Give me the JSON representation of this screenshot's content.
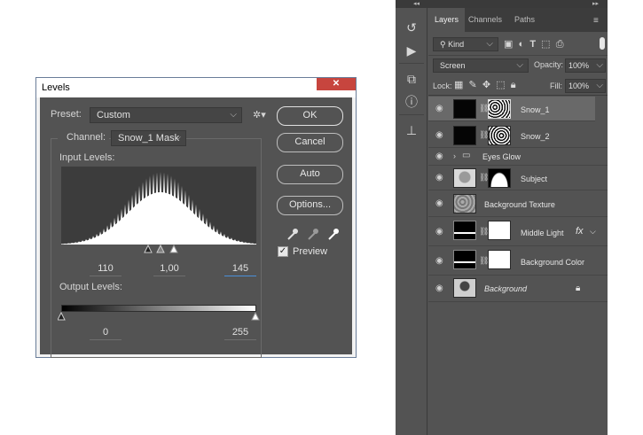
{
  "levels": {
    "title": "Levels",
    "close_label": "✕",
    "preset_label": "Preset:",
    "preset_value": "Custom",
    "channel_label": "Channel:",
    "channel_value": "Snow_1 Mask",
    "input_levels_label": "Input Levels:",
    "input_black": "110",
    "input_gamma": "1,00",
    "input_white": "145",
    "output_levels_label": "Output Levels:",
    "output_black": "0",
    "output_white": "255",
    "buttons": {
      "ok": "OK",
      "cancel": "Cancel",
      "auto": "Auto",
      "options": "Options..."
    },
    "preview_label": "Preview",
    "preview_checked": true
  },
  "layers_panel": {
    "tabs": [
      "Layers",
      "Channels",
      "Paths"
    ],
    "kind_label": "Kind",
    "blend_mode": "Screen",
    "opacity_label": "Opacity:",
    "opacity_value": "100%",
    "lock_label": "Lock:",
    "fill_label": "Fill:",
    "fill_value": "100%",
    "layers": [
      {
        "name": "Snow_1",
        "selected": true,
        "mask": true,
        "italic": false
      },
      {
        "name": "Snow_2",
        "selected": false,
        "mask": true,
        "italic": false
      },
      {
        "name": "Eyes Glow",
        "selected": false,
        "group": true,
        "italic": false
      },
      {
        "name": "Subject",
        "selected": false,
        "mask": true,
        "italic": false
      },
      {
        "name": "Background Texture",
        "selected": false,
        "mask": false,
        "italic": false
      },
      {
        "name": "Middle Light",
        "selected": false,
        "mask": true,
        "fx": "fx",
        "italic": false
      },
      {
        "name": "Background Color",
        "selected": false,
        "mask": true,
        "italic": false
      },
      {
        "name": "Background",
        "selected": false,
        "mask": false,
        "locked": true,
        "italic": true
      }
    ]
  },
  "colors": {
    "dialog_bg": "#535353",
    "accent": "#4a90d9",
    "selected_row": "#696969",
    "close_red": "#c7453e"
  }
}
